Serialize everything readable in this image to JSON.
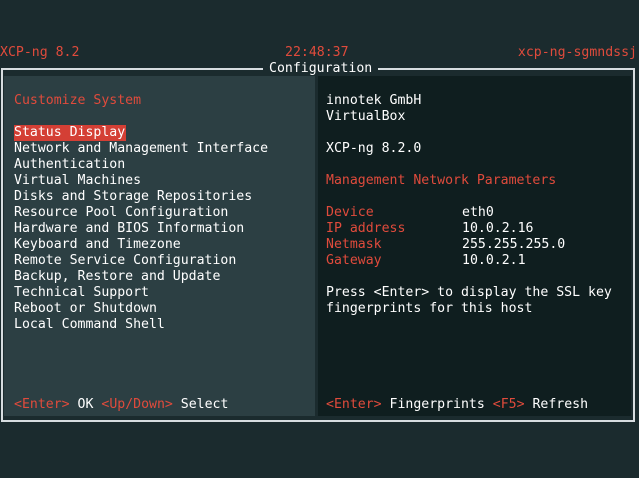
{
  "status_bar": {
    "version": "XCP-ng 8.2",
    "clock": "22:48:37",
    "hostname": "xcp-ng-sgmndssj"
  },
  "window": {
    "title": "Configuration"
  },
  "left_pane": {
    "heading": "Customize System",
    "menu": [
      "Status Display",
      "Network and Management Interface",
      "Authentication",
      "Virtual Machines",
      "Disks and Storage Repositories",
      "Resource Pool Configuration",
      "Hardware and BIOS Information",
      "Keyboard and Timezone",
      "Remote Service Configuration",
      "Backup, Restore and Update",
      "Technical Support",
      "Reboot or Shutdown",
      "Local Command Shell"
    ],
    "selected_index": 0,
    "footer": {
      "key1": "<Enter>",
      "action1": "OK",
      "key2": "<Up/Down>",
      "action2": "Select"
    }
  },
  "right_pane": {
    "vendor": "innotek GmbH",
    "product": "VirtualBox",
    "version": "XCP-ng 8.2.0",
    "section_title": "Management Network Parameters",
    "params": [
      {
        "label": "Device",
        "value": "eth0"
      },
      {
        "label": "IP address",
        "value": "10.0.2.16"
      },
      {
        "label": "Netmask",
        "value": "255.255.255.0"
      },
      {
        "label": "Gateway",
        "value": "10.0.2.1"
      }
    ],
    "hint_line1": "Press <Enter> to display the SSL key",
    "hint_line2": "fingerprints for this host",
    "footer": {
      "key1": "<Enter>",
      "action1": "Fingerprints",
      "key2": "<F5>",
      "action2": "Refresh"
    }
  },
  "colors": {
    "background": "#1b2b2e",
    "accent_red": "#e04b3c",
    "selection": "#d43f35",
    "left_pane": "#2c3f43",
    "right_pane": "#0f1e1f"
  }
}
